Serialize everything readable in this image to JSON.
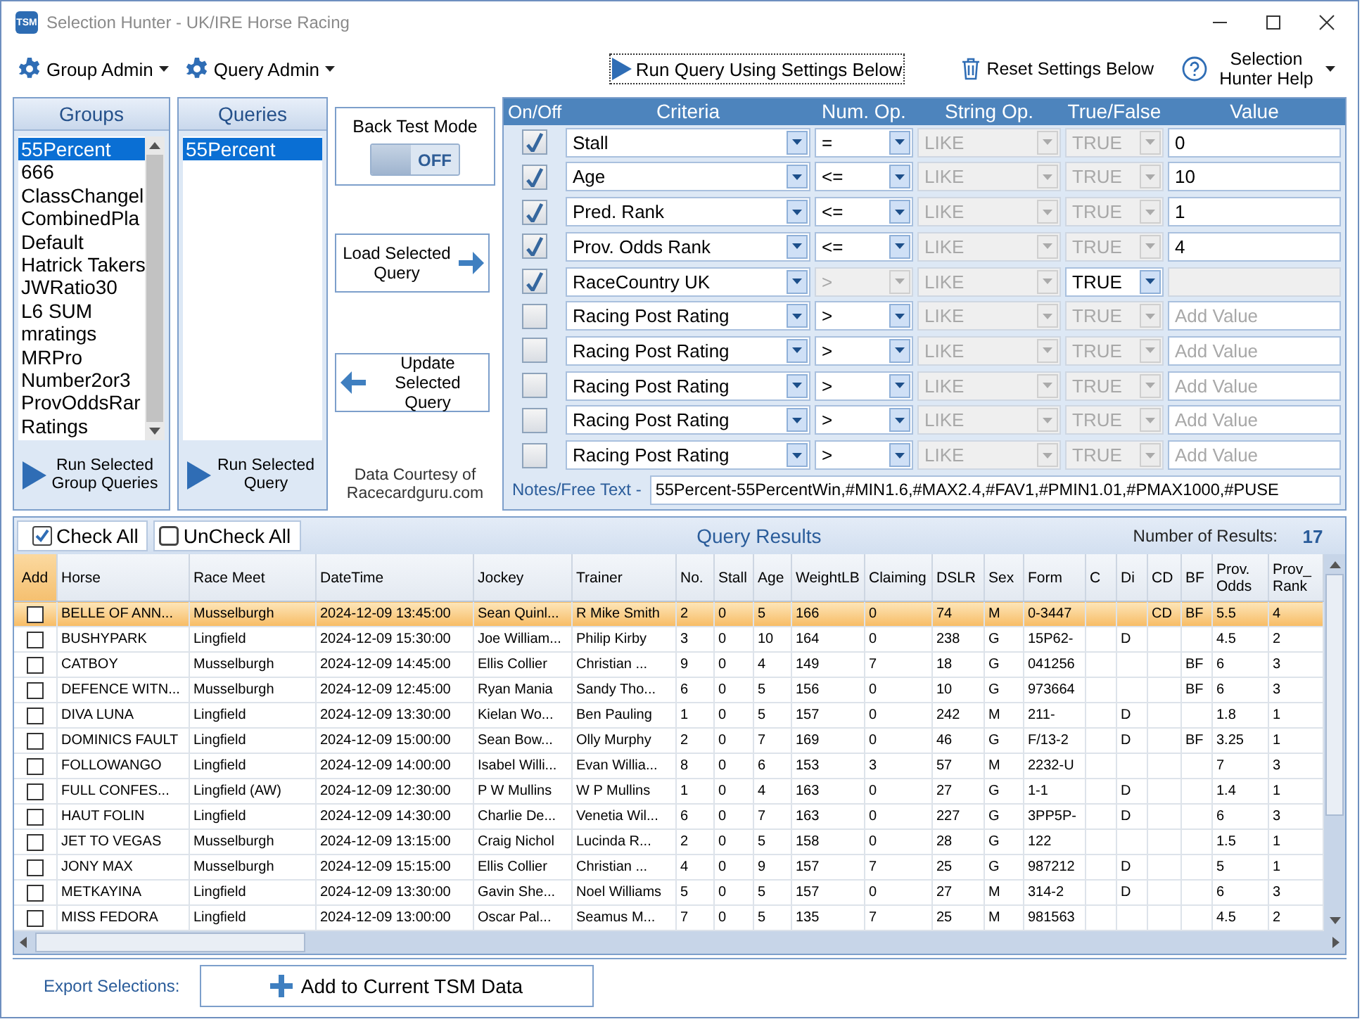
{
  "window": {
    "badge": "TSM",
    "title": "Selection Hunter - UK/IRE Horse Racing"
  },
  "toolbar": {
    "menus": [
      {
        "label": "Group Admin"
      },
      {
        "label": "Query Admin"
      }
    ],
    "run_button": "Run Query Using Settings Below",
    "reset_button": "Reset Settings Below",
    "help_button": "Selection Hunter Help"
  },
  "groups": {
    "title": "Groups",
    "items": [
      {
        "label": "55Percent",
        "selected": true
      },
      {
        "label": "666",
        "selected": false
      },
      {
        "label": "ClassChangel",
        "selected": false
      },
      {
        "label": "CombinedPla",
        "selected": false
      },
      {
        "label": "Default",
        "selected": false
      },
      {
        "label": "Hatrick Takers",
        "selected": false
      },
      {
        "label": "JWRatio30",
        "selected": false
      },
      {
        "label": "L6 SUM",
        "selected": false
      },
      {
        "label": "mratings",
        "selected": false
      },
      {
        "label": "MRPro",
        "selected": false
      },
      {
        "label": "Number2or3",
        "selected": false
      },
      {
        "label": "ProvOddsRar",
        "selected": false
      },
      {
        "label": "Ratings",
        "selected": false
      }
    ],
    "run_button": "Run Selected Group Queries"
  },
  "queries": {
    "title": "Queries",
    "items": [
      {
        "label": "55Percent",
        "selected": true
      }
    ],
    "run_button": "Run Selected Query"
  },
  "back_test": {
    "label": "Back Test Mode",
    "state_label": "OFF",
    "on": false
  },
  "load_button": "Load Selected Query",
  "update_button": "Update Selected Query",
  "credit": "Data Courtesy of Racecardguru.com",
  "criteria": {
    "columns": [
      "On/Off",
      "Criteria",
      "Num. Op.",
      "String Op.",
      "True/False",
      "Value"
    ],
    "rows": [
      {
        "checked": true,
        "criteria": "Stall",
        "num_op": "=",
        "num_op_disabled": false,
        "string_op": "LIKE",
        "string_op_disabled": true,
        "true_false": "TRUE",
        "true_false_disabled": true,
        "value": "0",
        "value_disabled": false
      },
      {
        "checked": true,
        "criteria": "Age",
        "num_op": "<=",
        "num_op_disabled": false,
        "string_op": "LIKE",
        "string_op_disabled": true,
        "true_false": "TRUE",
        "true_false_disabled": true,
        "value": "10",
        "value_disabled": false
      },
      {
        "checked": true,
        "criteria": "Pred. Rank",
        "num_op": "<=",
        "num_op_disabled": false,
        "string_op": "LIKE",
        "string_op_disabled": true,
        "true_false": "TRUE",
        "true_false_disabled": true,
        "value": "1",
        "value_disabled": false
      },
      {
        "checked": true,
        "criteria": "Prov. Odds Rank",
        "num_op": "<=",
        "num_op_disabled": false,
        "string_op": "LIKE",
        "string_op_disabled": true,
        "true_false": "TRUE",
        "true_false_disabled": true,
        "value": "4",
        "value_disabled": false
      },
      {
        "checked": true,
        "criteria": "RaceCountry UK",
        "num_op": ">",
        "num_op_disabled": true,
        "string_op": "LIKE",
        "string_op_disabled": true,
        "true_false": "TRUE",
        "true_false_disabled": false,
        "value_disabled": true
      },
      {
        "checked": false,
        "criteria": "Racing Post Rating",
        "num_op": ">",
        "num_op_disabled": false,
        "string_op": "LIKE",
        "string_op_disabled": true,
        "true_false": "TRUE",
        "true_false_disabled": true,
        "placeholder": "Add Value",
        "value_disabled": false
      },
      {
        "checked": false,
        "criteria": "Racing Post Rating",
        "num_op": ">",
        "num_op_disabled": false,
        "string_op": "LIKE",
        "string_op_disabled": true,
        "true_false": "TRUE",
        "true_false_disabled": true,
        "placeholder": "Add Value",
        "value_disabled": false
      },
      {
        "checked": false,
        "criteria": "Racing Post Rating",
        "num_op": ">",
        "num_op_disabled": false,
        "string_op": "LIKE",
        "string_op_disabled": true,
        "true_false": "TRUE",
        "true_false_disabled": true,
        "placeholder": "Add Value",
        "value_disabled": false
      },
      {
        "checked": false,
        "criteria": "Racing Post Rating",
        "num_op": ">",
        "num_op_disabled": false,
        "string_op": "LIKE",
        "string_op_disabled": true,
        "true_false": "TRUE",
        "true_false_disabled": true,
        "placeholder": "Add Value",
        "value_disabled": false
      },
      {
        "checked": false,
        "criteria": "Racing Post Rating",
        "num_op": ">",
        "num_op_disabled": false,
        "string_op": "LIKE",
        "string_op_disabled": true,
        "true_false": "TRUE",
        "true_false_disabled": true,
        "placeholder": "Add Value",
        "value_disabled": false
      }
    ],
    "notes_label": "Notes/Free Text -",
    "notes": "55Percent-55PercentWin,#MIN1.6,#MAX2.4,#FAV1,#PMIN1.01,#PMAX1000,#PUSE"
  },
  "results": {
    "check_all": "Check All",
    "uncheck_all": "UnCheck All",
    "title": "Query Results",
    "count_label": "Number of Results:",
    "count": "17",
    "columns": [
      "Add",
      "Horse",
      "Race Meet",
      "DateTime",
      "Jockey",
      "Trainer",
      "No.",
      "Stall",
      "Age",
      "WeightLB",
      "Claiming",
      "DSLR",
      "Sex",
      "Form",
      "C",
      "Di",
      "CD",
      "BF",
      "Prov. Odds",
      "Prov_ Rank"
    ],
    "rows": [
      {
        "selected": true,
        "checked": false,
        "cells": [
          "",
          "BELLE OF ANN...",
          "Musselburgh",
          "2024-12-09 13:45:00",
          "Sean Quinl...",
          "R Mike Smith",
          "2",
          "0",
          "5",
          "166",
          "0",
          "74",
          "M",
          "0-3447",
          "",
          "",
          "CD",
          "BF",
          "5.5",
          "4"
        ]
      },
      {
        "selected": false,
        "checked": false,
        "cells": [
          "",
          "BUSHYPARK",
          "Lingfield",
          "2024-12-09 15:30:00",
          "Joe William...",
          "Philip Kirby",
          "3",
          "0",
          "10",
          "164",
          "0",
          "238",
          "G",
          "15P62-",
          "",
          "D",
          "",
          "",
          "4.5",
          "2"
        ]
      },
      {
        "selected": false,
        "checked": false,
        "cells": [
          "",
          "CATBOY",
          "Musselburgh",
          "2024-12-09 14:45:00",
          "Ellis Collier",
          "Christian ...",
          "9",
          "0",
          "4",
          "149",
          "7",
          "18",
          "G",
          "041256",
          "",
          "",
          "",
          "BF",
          "6",
          "3"
        ]
      },
      {
        "selected": false,
        "checked": false,
        "cells": [
          "",
          "DEFENCE WITN...",
          "Musselburgh",
          "2024-12-09 12:45:00",
          "Ryan Mania",
          "Sandy Tho...",
          "6",
          "0",
          "5",
          "156",
          "0",
          "10",
          "G",
          "973664",
          "",
          "",
          "",
          "BF",
          "6",
          "3"
        ]
      },
      {
        "selected": false,
        "checked": false,
        "cells": [
          "",
          "DIVA LUNA",
          "Lingfield",
          "2024-12-09 13:30:00",
          "Kielan Wo...",
          "Ben Pauling",
          "1",
          "0",
          "5",
          "157",
          "0",
          "242",
          "M",
          "211-",
          "",
          "D",
          "",
          "",
          "1.8",
          "1"
        ]
      },
      {
        "selected": false,
        "checked": false,
        "cells": [
          "",
          "DOMINICS FAULT",
          "Lingfield",
          "2024-12-09 15:00:00",
          "Sean Bow...",
          "Olly Murphy",
          "2",
          "0",
          "7",
          "169",
          "0",
          "46",
          "G",
          "F/13-2",
          "",
          "D",
          "",
          "BF",
          "3.25",
          "1"
        ]
      },
      {
        "selected": false,
        "checked": false,
        "cells": [
          "",
          "FOLLOWANGO",
          "Lingfield",
          "2024-12-09 14:00:00",
          "Isabel Willi...",
          "Evan Willia...",
          "8",
          "0",
          "6",
          "153",
          "3",
          "57",
          "M",
          "2232-U",
          "",
          "",
          "",
          "",
          "7",
          "3"
        ]
      },
      {
        "selected": false,
        "checked": false,
        "cells": [
          "",
          "FULL CONFES...",
          "Lingfield (AW)",
          "2024-12-09 12:30:00",
          "P W Mullins",
          "W P Mullins",
          "1",
          "0",
          "4",
          "163",
          "0",
          "27",
          "G",
          "1-1",
          "",
          "D",
          "",
          "",
          "1.4",
          "1"
        ]
      },
      {
        "selected": false,
        "checked": false,
        "cells": [
          "",
          "HAUT FOLIN",
          "Lingfield",
          "2024-12-09 14:30:00",
          "Charlie De...",
          "Venetia Wil...",
          "6",
          "0",
          "7",
          "163",
          "0",
          "227",
          "G",
          "3PP5P-",
          "",
          "D",
          "",
          "",
          "6",
          "3"
        ]
      },
      {
        "selected": false,
        "checked": false,
        "cells": [
          "",
          "JET TO VEGAS",
          "Musselburgh",
          "2024-12-09 13:15:00",
          "Craig Nichol",
          "Lucinda R...",
          "2",
          "0",
          "5",
          "158",
          "0",
          "28",
          "G",
          "122",
          "",
          "",
          "",
          "",
          "1.5",
          "1"
        ]
      },
      {
        "selected": false,
        "checked": false,
        "cells": [
          "",
          "JONY MAX",
          "Musselburgh",
          "2024-12-09 15:15:00",
          "Ellis Collier",
          "Christian ...",
          "4",
          "0",
          "9",
          "157",
          "7",
          "25",
          "G",
          "987212",
          "",
          "D",
          "",
          "",
          "5",
          "1"
        ]
      },
      {
        "selected": false,
        "checked": false,
        "cells": [
          "",
          "METKAYINA",
          "Lingfield",
          "2024-12-09 13:30:00",
          "Gavin She...",
          "Noel Williams",
          "5",
          "0",
          "5",
          "157",
          "0",
          "27",
          "M",
          "314-2",
          "",
          "D",
          "",
          "",
          "6",
          "3"
        ]
      },
      {
        "selected": false,
        "checked": false,
        "cells": [
          "",
          "MISS FEDORA",
          "Lingfield",
          "2024-12-09 13:00:00",
          "Oscar Pal...",
          "Seamus M...",
          "7",
          "0",
          "5",
          "135",
          "7",
          "25",
          "M",
          "981563",
          "",
          "",
          "",
          "",
          "4.5",
          "2"
        ]
      }
    ]
  },
  "export": {
    "label": "Export Selections:",
    "button": "Add to Current TSM Data"
  }
}
